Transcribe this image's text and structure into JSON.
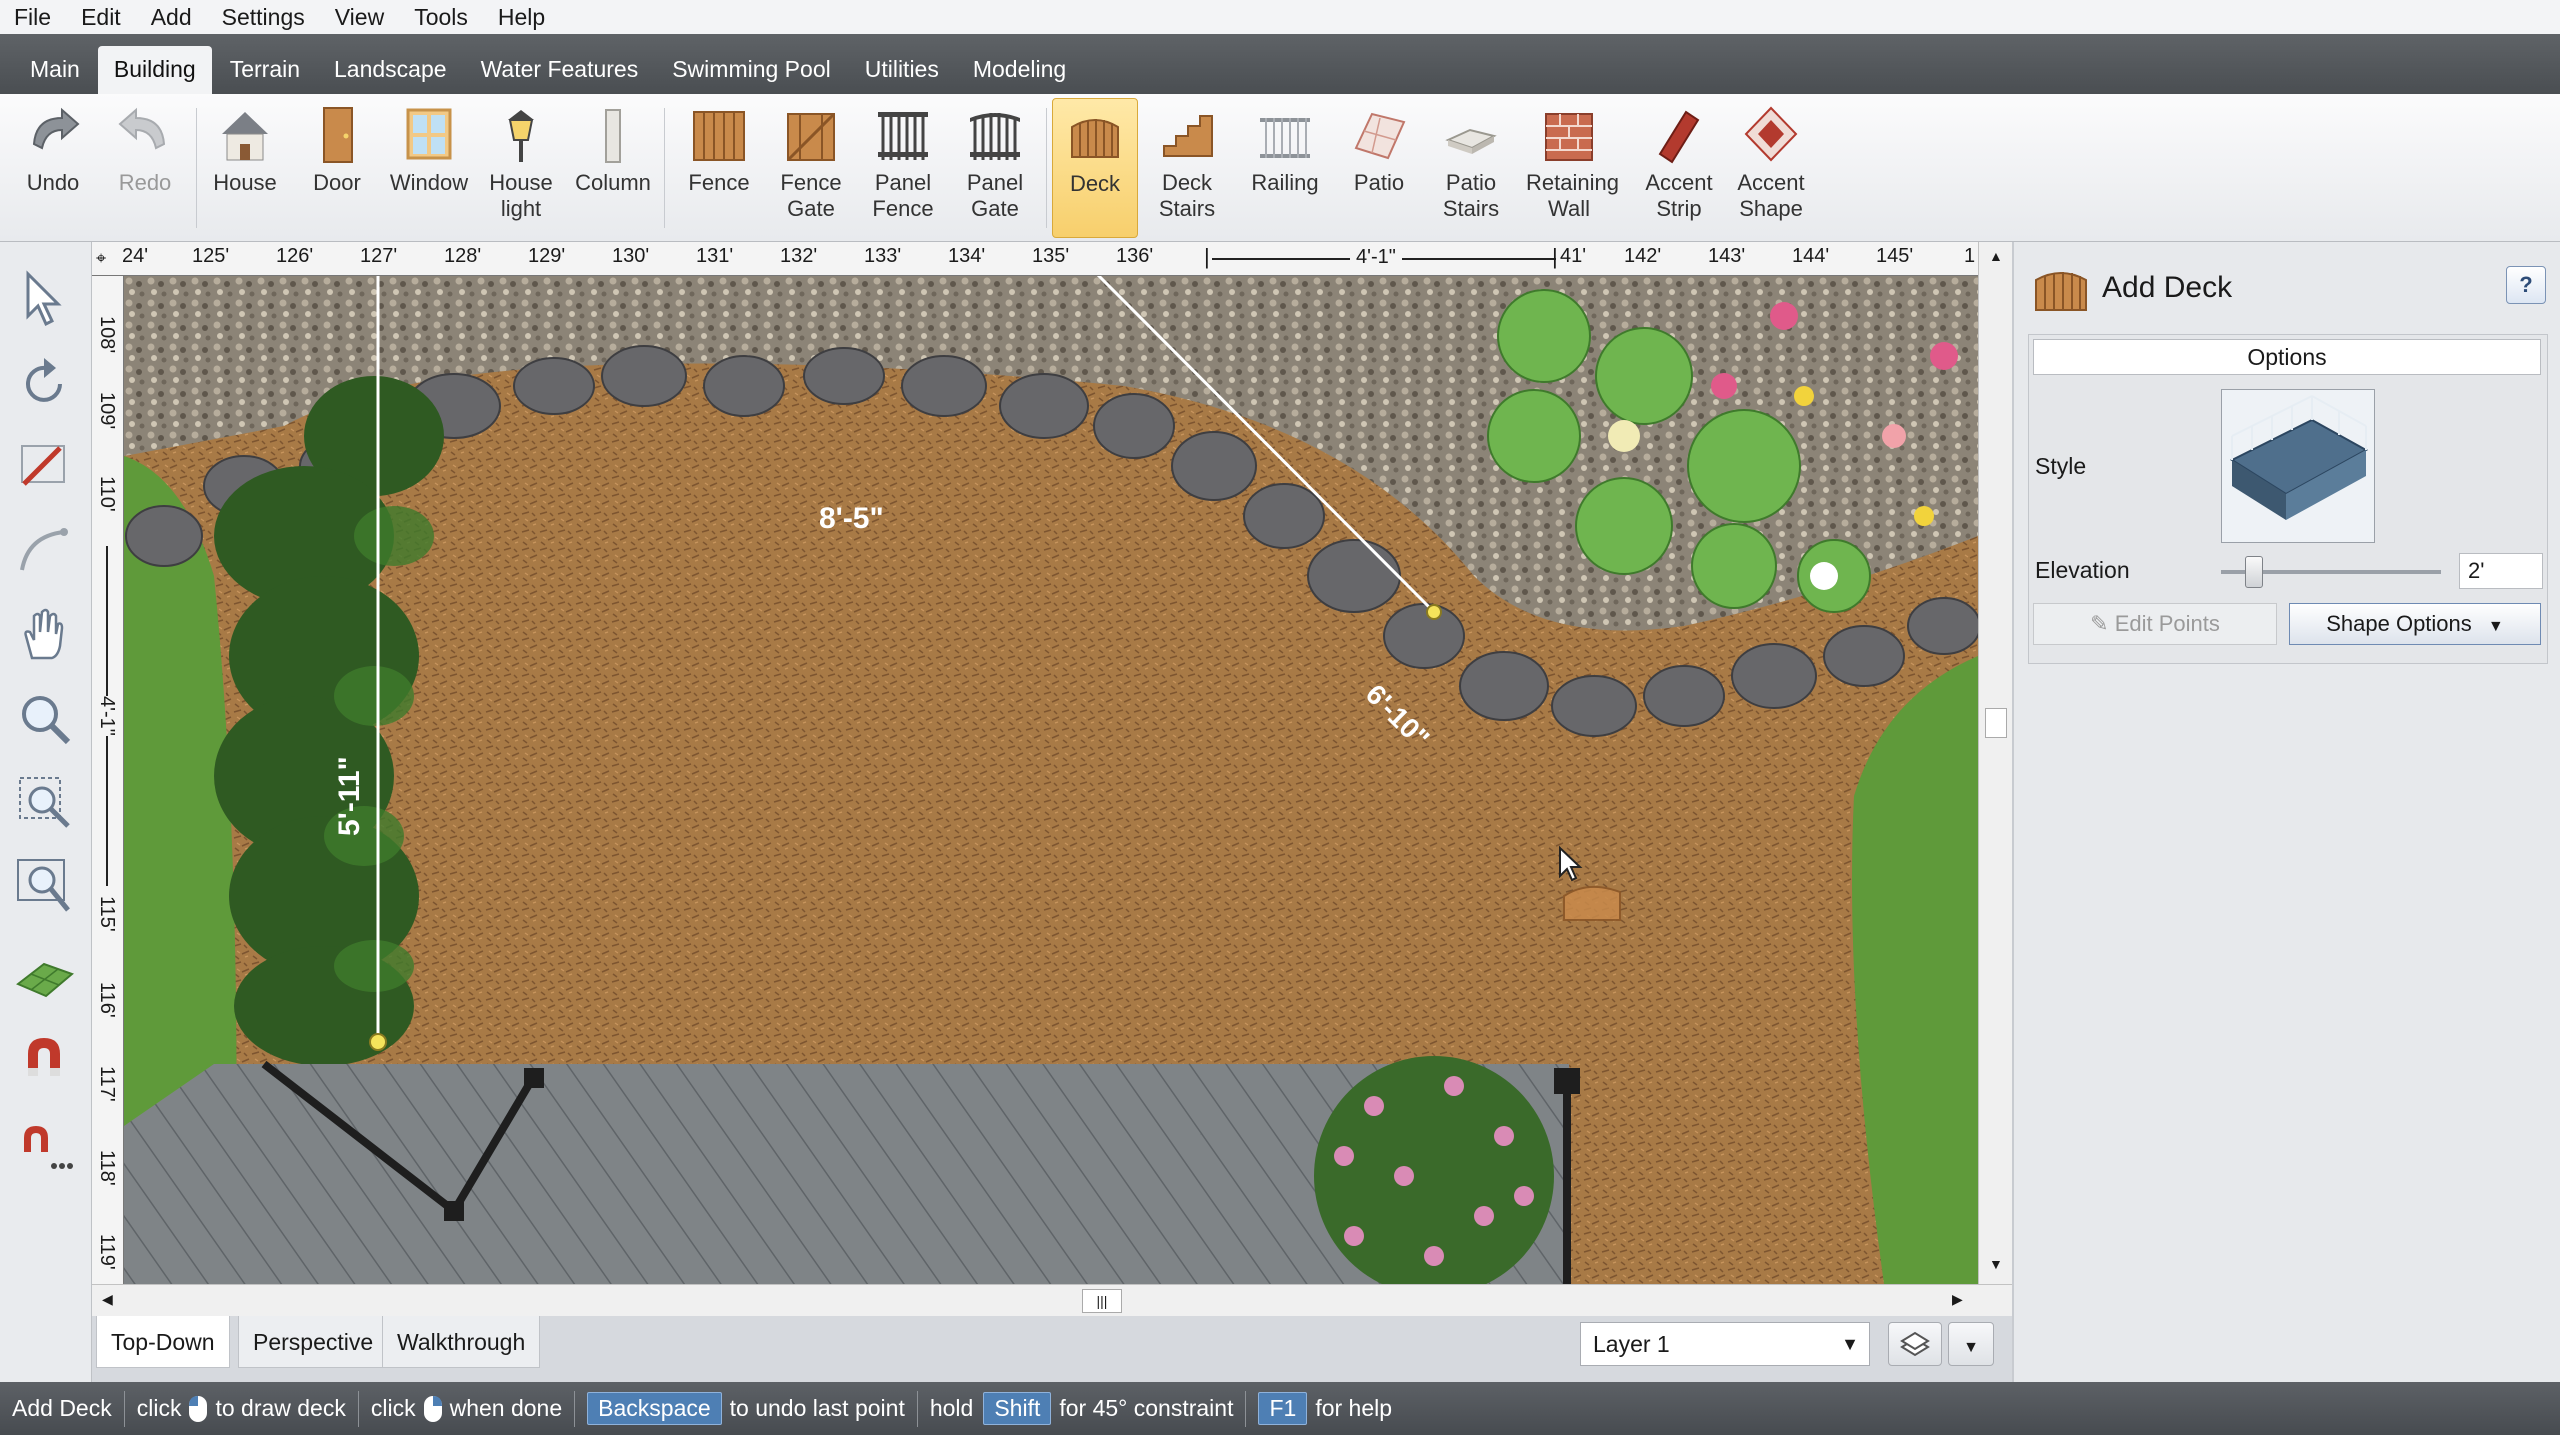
{
  "menu": [
    "File",
    "Edit",
    "Add",
    "Settings",
    "View",
    "Tools",
    "Help"
  ],
  "tabs": [
    {
      "label": "Main",
      "active": false
    },
    {
      "label": "Building",
      "active": true
    },
    {
      "label": "Terrain",
      "active": false
    },
    {
      "label": "Landscape",
      "active": false
    },
    {
      "label": "Water Features",
      "active": false
    },
    {
      "label": "Swimming Pool",
      "active": false
    },
    {
      "label": "Utilities",
      "active": false
    },
    {
      "label": "Modeling",
      "active": false
    }
  ],
  "toolbar": {
    "undo": "Undo",
    "redo": "Redo",
    "house": "House",
    "door": "Door",
    "window": "Window",
    "house_light_1": "House",
    "house_light_2": "light",
    "column": "Column",
    "fence": "Fence",
    "fence_gate_1": "Fence",
    "fence_gate_2": "Gate",
    "panel_fence_1": "Panel",
    "panel_fence_2": "Fence",
    "panel_gate_1": "Panel",
    "panel_gate_2": "Gate",
    "deck": "Deck",
    "deck_stairs_1": "Deck",
    "deck_stairs_2": "Stairs",
    "railing": "Railing",
    "patio": "Patio",
    "patio_stairs_1": "Patio",
    "patio_stairs_2": "Stairs",
    "retaining_wall_1": "Retaining",
    "retaining_wall_2": "Wall",
    "accent_strip_1": "Accent",
    "accent_strip_2": "Strip",
    "accent_shape_1": "Accent",
    "accent_shape_2": "Shape"
  },
  "ruler": {
    "h_labels": [
      "24'",
      "125'",
      "126'",
      "127'",
      "128'",
      "129'",
      "130'",
      "131'",
      "132'",
      "133'",
      "134'",
      "135'",
      "136'",
      "41'",
      "142'",
      "143'",
      "144'",
      "145'",
      "1"
    ],
    "h_measure": "4'-1\"",
    "v_labels": [
      "108'",
      "109'",
      "110'",
      "115'",
      "116'",
      "117'",
      "118'",
      "119'"
    ],
    "v_measure": "4'-1\""
  },
  "dimensions": {
    "top": "8'-5\"",
    "diagonal": "6'-10\"",
    "left": "5'-11\""
  },
  "view_tabs": {
    "top_down": "Top-Down",
    "perspective": "Perspective",
    "walkthrough": "Walkthrough"
  },
  "layer": {
    "selected": "Layer 1"
  },
  "panel": {
    "title": "Add Deck",
    "help": "?",
    "options_header": "Options",
    "style_label": "Style",
    "elevation_label": "Elevation",
    "elevation_value": "2'",
    "elevation_fraction": 0.15,
    "edit_points": "Edit Points",
    "shape_options": "Shape Options"
  },
  "status": {
    "mode": "Add Deck",
    "click1": "click",
    "draw": "to draw deck",
    "click2": "click",
    "done": "when done",
    "backspace": "Backspace",
    "undo_last": "to undo last point",
    "hold": "hold",
    "shift": "Shift",
    "constraint": "for 45° constraint",
    "f1": "F1",
    "help": "for help"
  },
  "colors": {
    "accent": "#f7cf6c",
    "status_key": "#4e7fb4",
    "mulch": "#a87a46",
    "grass": "#5f9a3a",
    "deck_boards": "#7f8487"
  }
}
